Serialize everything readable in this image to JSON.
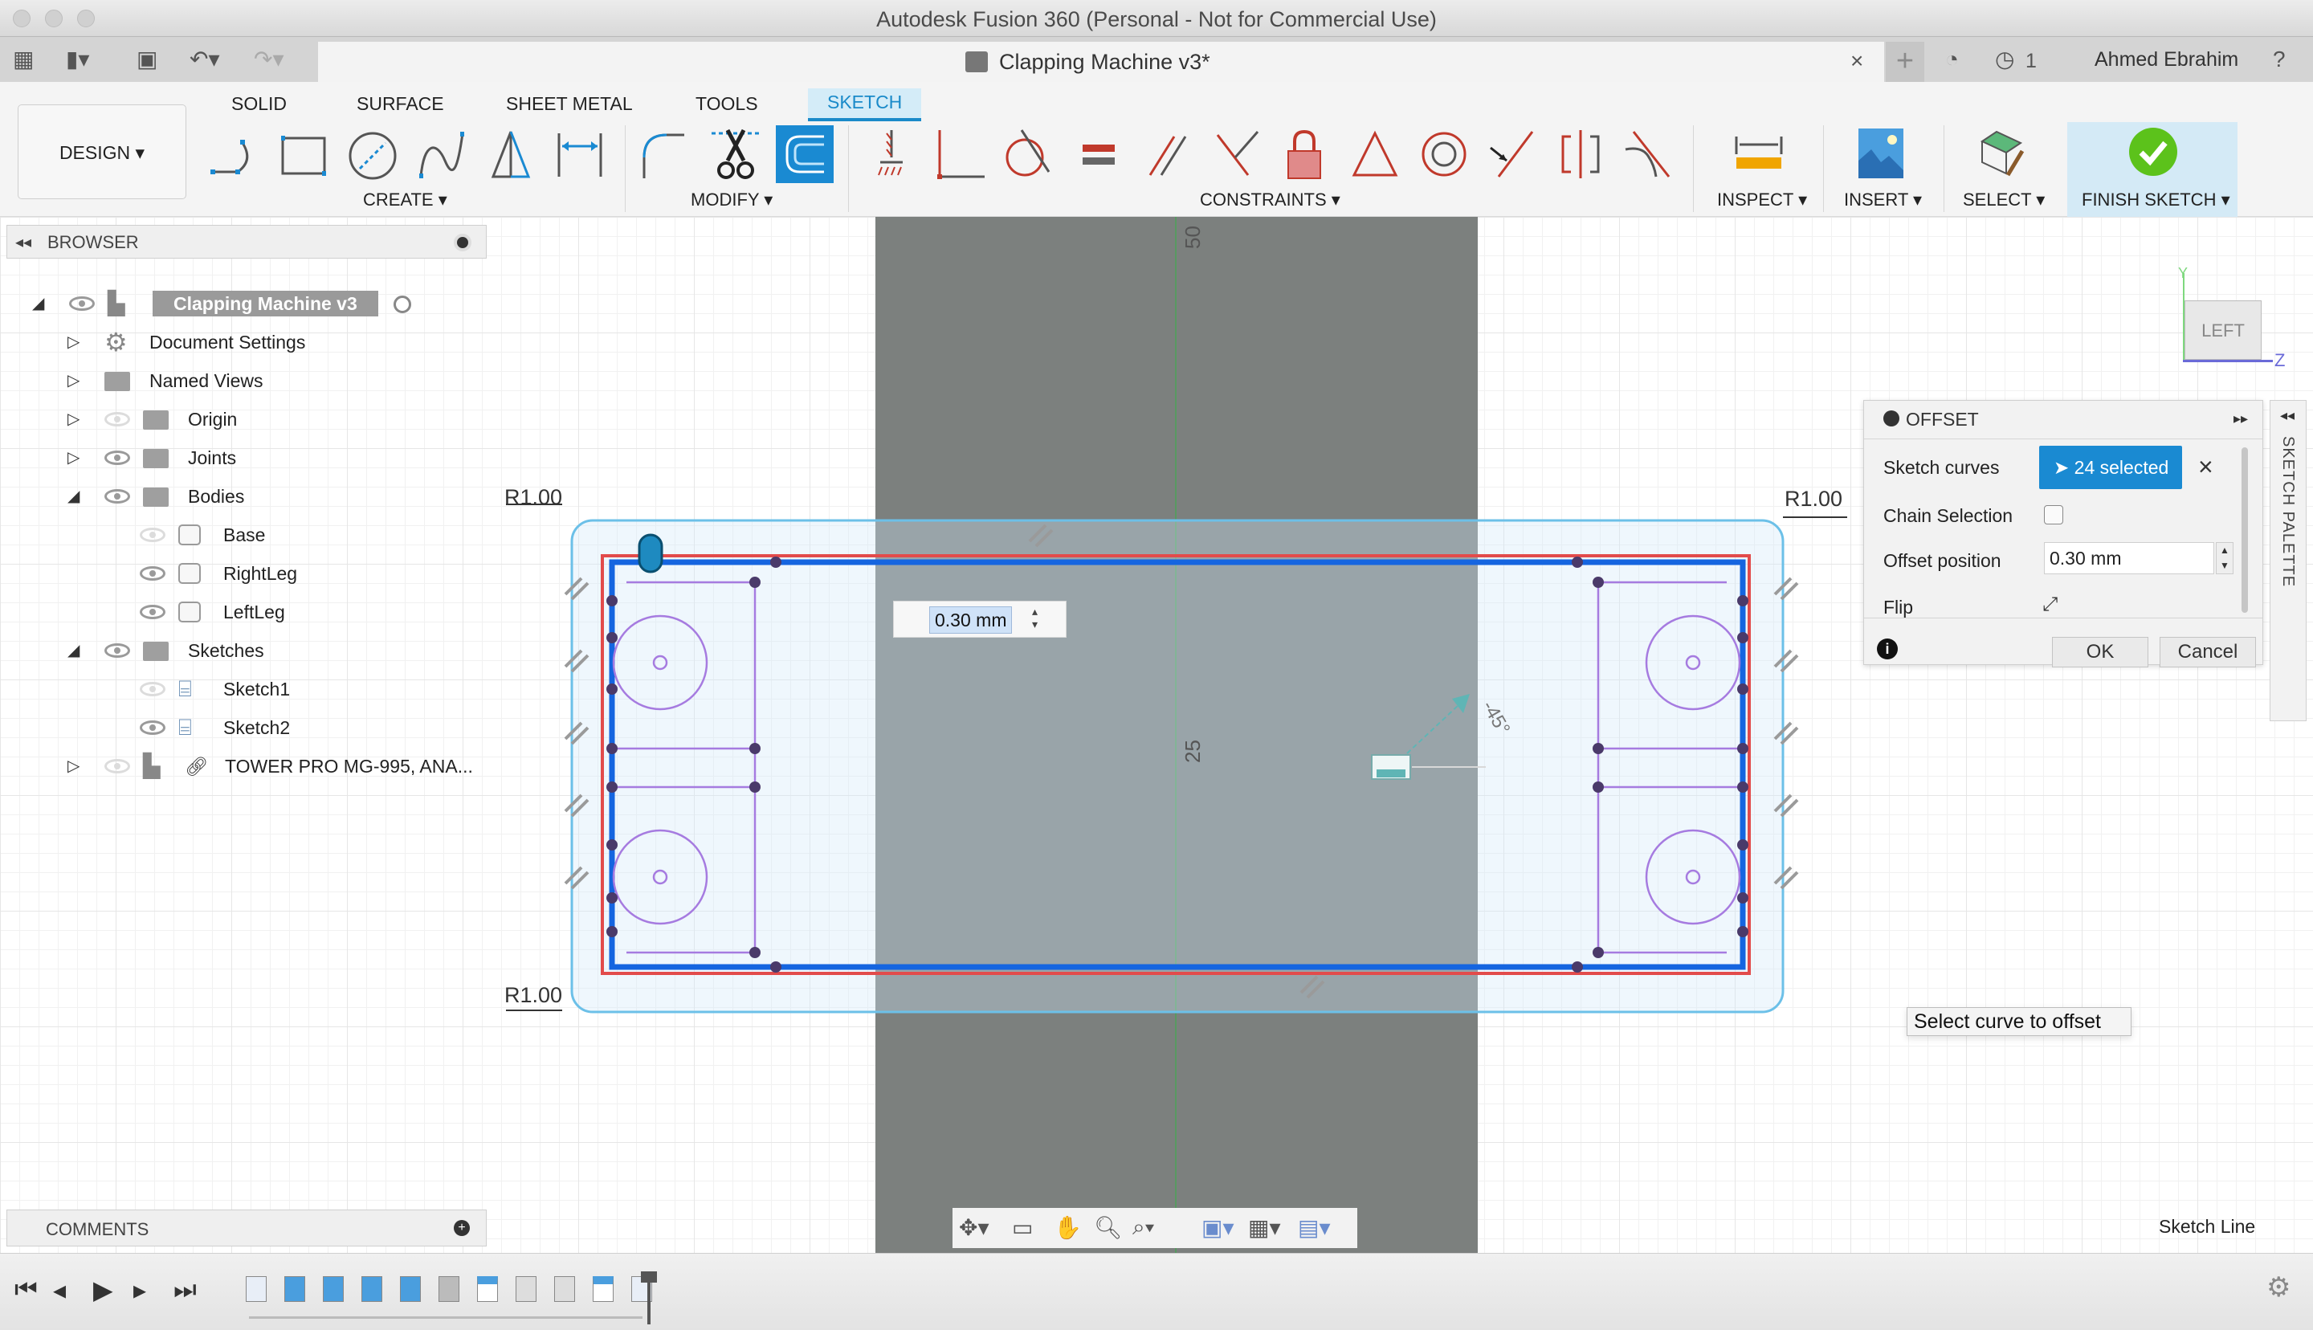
{
  "window": {
    "title": "Autodesk Fusion 360 (Personal - Not for Commercial Use)"
  },
  "quick_access": {
    "document_tab_title": "Clapping Machine v3*",
    "jobs_count": "1",
    "user_name": "Ahmed Ebrahim",
    "icons": [
      "app-grid-icon",
      "file-icon",
      "save-icon",
      "undo-icon",
      "redo-icon",
      "close-tab-icon",
      "new-tab-icon",
      "extensions-icon",
      "job-status-icon",
      "help-icon"
    ]
  },
  "ribbon": {
    "workspace_label": "DESIGN",
    "tabs": [
      {
        "label": "SOLID",
        "active": false
      },
      {
        "label": "SURFACE",
        "active": false
      },
      {
        "label": "SHEET METAL",
        "active": false
      },
      {
        "label": "TOOLS",
        "active": false
      },
      {
        "label": "SKETCH",
        "active": true
      }
    ],
    "groups": {
      "create": "CREATE",
      "modify": "MODIFY",
      "constraints": "CONSTRAINTS",
      "inspect": "INSPECT",
      "insert": "INSERT",
      "select": "SELECT",
      "finish": "FINISH SKETCH"
    },
    "create_tools": [
      "line",
      "rectangle",
      "circle",
      "spline",
      "mirror",
      "sketch-dimension"
    ],
    "modify_tools": [
      "fillet",
      "trim",
      "offset"
    ],
    "constraint_tools": [
      "fix",
      "coincident",
      "tangent",
      "equal",
      "parallel",
      "perpendicular",
      "lock",
      "midpoint",
      "concentric",
      "collinear",
      "symmetry",
      "curvature"
    ],
    "active_tool": "offset"
  },
  "browser": {
    "title": "BROWSER",
    "items": [
      {
        "label": "Clapping Machine v3",
        "level": 0,
        "expanded": true,
        "visible": true,
        "icon": "component"
      },
      {
        "label": "Document Settings",
        "level": 1,
        "expanded": false,
        "icon": "gear"
      },
      {
        "label": "Named Views",
        "level": 1,
        "expanded": false,
        "icon": "folder"
      },
      {
        "label": "Origin",
        "level": 1,
        "expanded": false,
        "visible": false,
        "icon": "folder"
      },
      {
        "label": "Joints",
        "level": 1,
        "expanded": false,
        "visible": true,
        "icon": "folder"
      },
      {
        "label": "Bodies",
        "level": 1,
        "expanded": true,
        "visible": true,
        "icon": "folder"
      },
      {
        "label": "Base",
        "level": 2,
        "visible": false,
        "icon": "body"
      },
      {
        "label": "RightLeg",
        "level": 2,
        "visible": true,
        "icon": "body"
      },
      {
        "label": "LeftLeg",
        "level": 2,
        "visible": true,
        "icon": "body"
      },
      {
        "label": "Sketches",
        "level": 1,
        "expanded": true,
        "visible": true,
        "icon": "folder"
      },
      {
        "label": "Sketch1",
        "level": 2,
        "visible": false,
        "icon": "sketch"
      },
      {
        "label": "Sketch2",
        "level": 2,
        "visible": true,
        "icon": "sketch"
      },
      {
        "label": "TOWER PRO MG-995, ANA...",
        "level": 1,
        "expanded": false,
        "visible": false,
        "icon": "linked-component"
      }
    ]
  },
  "canvas": {
    "dimension_labels": [
      "R1.00",
      "R1.00",
      "R1.00"
    ],
    "ruler_labels": [
      "50",
      "25"
    ],
    "angle_label": "-45°",
    "floating_input_value": "0.30 mm",
    "view_cube_face": "LEFT",
    "axis_labels": {
      "y": "Y",
      "z": "Z"
    },
    "hint": "Select curve to offset",
    "status": "Sketch Line"
  },
  "offset_dialog": {
    "title": "OFFSET",
    "sketch_curves_label": "Sketch curves",
    "sketch_curves_value": "24 selected",
    "chain_selection_label": "Chain Selection",
    "chain_selection_checked": false,
    "offset_position_label": "Offset position",
    "offset_position_value": "0.30 mm",
    "flip_label": "Flip",
    "ok_label": "OK",
    "cancel_label": "Cancel"
  },
  "sketch_palette": {
    "label": "SKETCH PALETTE"
  },
  "comments": {
    "title": "COMMENTS"
  },
  "timeline": {
    "controls": [
      "go-to-start",
      "step-back",
      "play",
      "step-forward",
      "go-to-end"
    ],
    "features": [
      "sketch",
      "extrude",
      "extrude",
      "extrude",
      "extrude",
      "joint",
      "rigid-group",
      "as-built-joint",
      "as-built-joint",
      "rigid-group",
      "sketch"
    ]
  },
  "colors": {
    "accent": "#1a8ad2",
    "selected_curve": "#1565e0",
    "offset_preview": "#e24b4b",
    "construction": "#a67be0",
    "body_dark": "#7c807e",
    "finish_green": "#5cc21b"
  }
}
